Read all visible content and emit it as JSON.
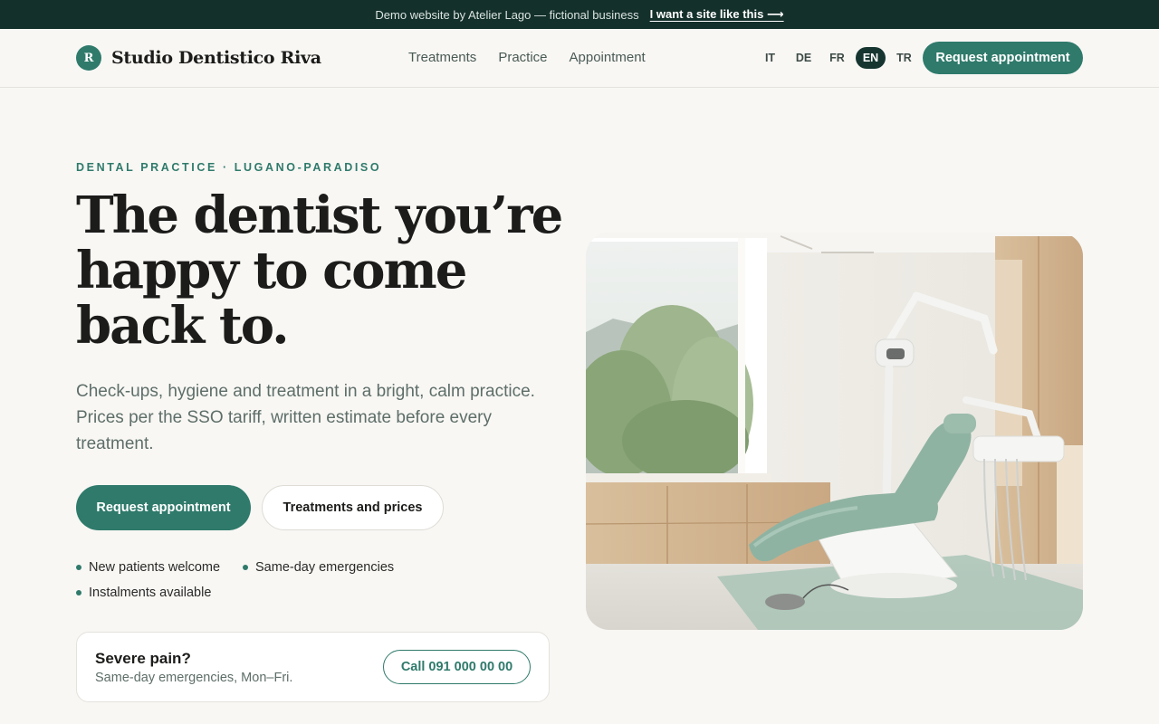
{
  "topbar": {
    "text": "Demo website by Atelier Lago — fictional business",
    "link": "I want a site like this ⟶"
  },
  "header": {
    "logo_letter": "R",
    "brand": "Studio Dentistico Riva",
    "nav": [
      "Treatments",
      "Practice",
      "Appointment"
    ],
    "languages": [
      "IT",
      "DE",
      "FR",
      "EN",
      "TR"
    ],
    "active_language": "EN",
    "cta": "Request appointment"
  },
  "hero": {
    "eyebrow": "DENTAL PRACTICE · LUGANO-PARADISO",
    "headline": [
      "The dentist you’re",
      "happy to come",
      "back to."
    ],
    "subtext": "Check-ups, hygiene and treatment in a bright, calm practice. Prices per the SSO tariff, written estimate before every treatment.",
    "primary_button": "Request appointment",
    "secondary_button": "Treatments and prices",
    "features": [
      "New patients welcome",
      "Same-day emergencies",
      "Instalments available"
    ]
  },
  "emergency": {
    "title": "Severe pain?",
    "subtitle": "Same-day emergencies, Mon–Fri.",
    "call_button": "Call 091 000 00 00"
  },
  "image": {
    "description_icon": "dental-chair-photo"
  },
  "colors": {
    "accent": "#2f7a6b",
    "topbar_bg": "#14302b",
    "page_bg": "#f8f7f4"
  }
}
